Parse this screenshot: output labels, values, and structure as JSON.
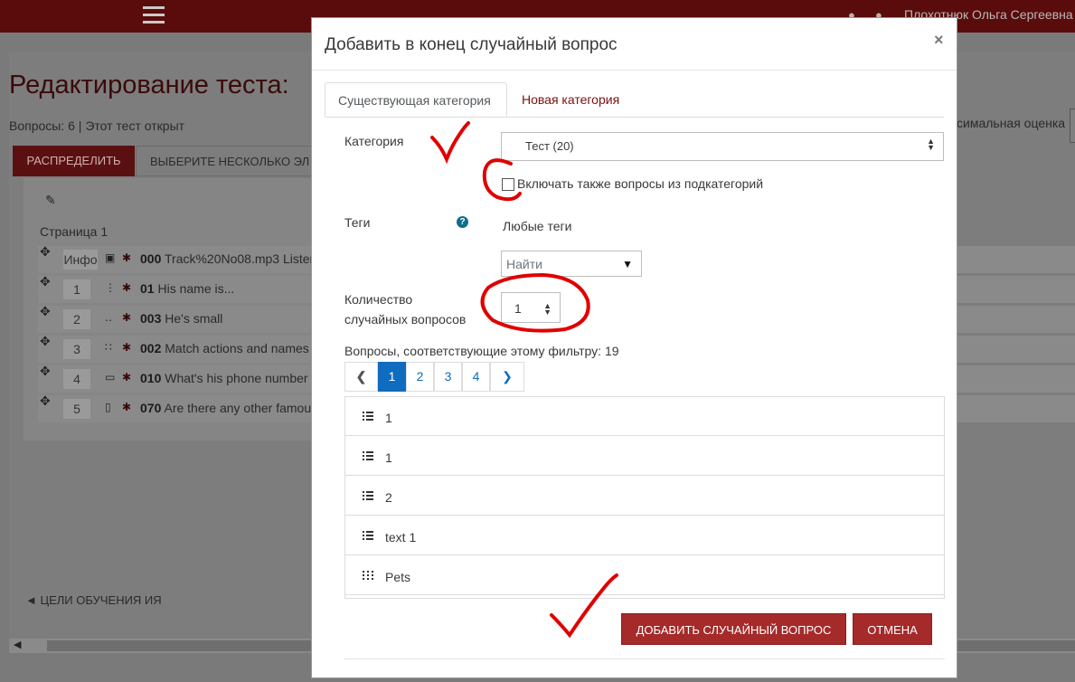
{
  "header": {
    "user_name": "Плохотнюк Ольга Сергеевна"
  },
  "background": {
    "title": "Редактирование теста:",
    "info": "Вопросы: 6 | Этот тест открыт",
    "max_grade_label": "симальная оценка",
    "distribute_button": "РАСПРЕДЕЛИТЬ",
    "select_multiple_button": "ВЫБЕРИТЕ НЕСКОЛЬКО ЭЛ",
    "page_label": "Страница 1",
    "questions": [
      {
        "num": "Инфо",
        "id": "000",
        "text": "Track%20No08.mp3 Listen"
      },
      {
        "num": "1",
        "id": "01",
        "text": "His name is..."
      },
      {
        "num": "2",
        "id": "003",
        "text": "He's small"
      },
      {
        "num": "3",
        "id": "002",
        "text": "Match actions and names"
      },
      {
        "num": "4",
        "id": "010",
        "text": "What's his phone number"
      },
      {
        "num": "5",
        "id": "070",
        "text": "Are there any other famous"
      }
    ],
    "goals_link": "◄ ЦЕЛИ ОБУЧЕНИЯ ИЯ"
  },
  "modal": {
    "title": "Добавить в конец случайный вопрос",
    "close": "×",
    "tabs": [
      "Существующая категория",
      "Новая категория"
    ],
    "category_label": "Категория",
    "category_value": "Тест (20)",
    "include_subcategories_label": "Включать также вопросы из подкатегорий",
    "include_subcategories_checked": false,
    "tags_label": "Теги",
    "tags_help": "?",
    "tags_any": "Любые теги",
    "tags_search_placeholder": "Найти",
    "count_label_line1": "Количество",
    "count_label_line2": "случайных вопросов",
    "count_value": "1",
    "matching_text": "Вопросы, соответствующие этому фильтру: 19",
    "pager": {
      "pages": [
        "1",
        "2",
        "3",
        "4"
      ],
      "current": "1",
      "prev": "‹",
      "next": "›"
    },
    "question_list": [
      {
        "icon": "list-icon",
        "text": "1"
      },
      {
        "icon": "list-icon",
        "text": "1"
      },
      {
        "icon": "list-icon",
        "text": "2"
      },
      {
        "icon": "list-icon",
        "text": "text 1"
      },
      {
        "icon": "grid-icon",
        "text": "Pets"
      }
    ],
    "add_button": "ДОБАВИТЬ СЛУЧАЙНЫЙ ВОПРОС",
    "cancel_button": "ОТМЕНА"
  },
  "colors": {
    "brand": "#a52a2a",
    "link": "#0f6cbf",
    "annotation": "#e00000"
  }
}
